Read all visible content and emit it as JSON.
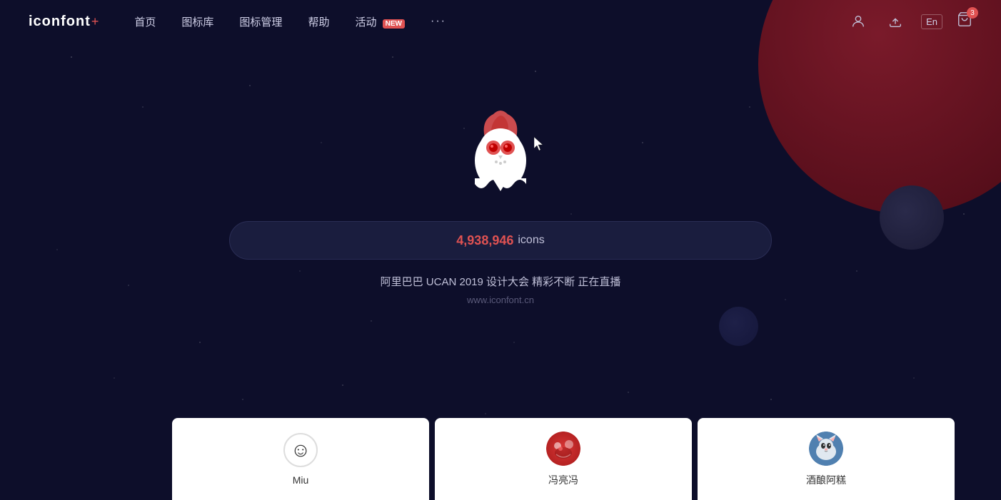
{
  "site": {
    "logo": "iconfont",
    "logo_plus": "+",
    "url": "www.iconfont.cn"
  },
  "nav": {
    "links": [
      {
        "id": "home",
        "label": "首页"
      },
      {
        "id": "library",
        "label": "图标库"
      },
      {
        "id": "manage",
        "label": "图标管理"
      },
      {
        "id": "help",
        "label": "帮助"
      },
      {
        "id": "activity",
        "label": "活动",
        "badge": "NEW"
      }
    ],
    "more_dots": "···",
    "lang": "En",
    "cart_count": "3"
  },
  "hero": {
    "icon_count": "4,938,946",
    "icon_label": "icons",
    "promo": "阿里巴巴 UCAN 2019 设计大会 精彩不断 正在直播"
  },
  "cards": [
    {
      "id": "miu",
      "name": "Miu",
      "avatar_type": "smiley"
    },
    {
      "id": "fengliang",
      "name": "冯亮冯",
      "avatar_type": "flm"
    },
    {
      "id": "jiujiu",
      "name": "酒酿阿糕",
      "avatar_type": "jj"
    }
  ]
}
